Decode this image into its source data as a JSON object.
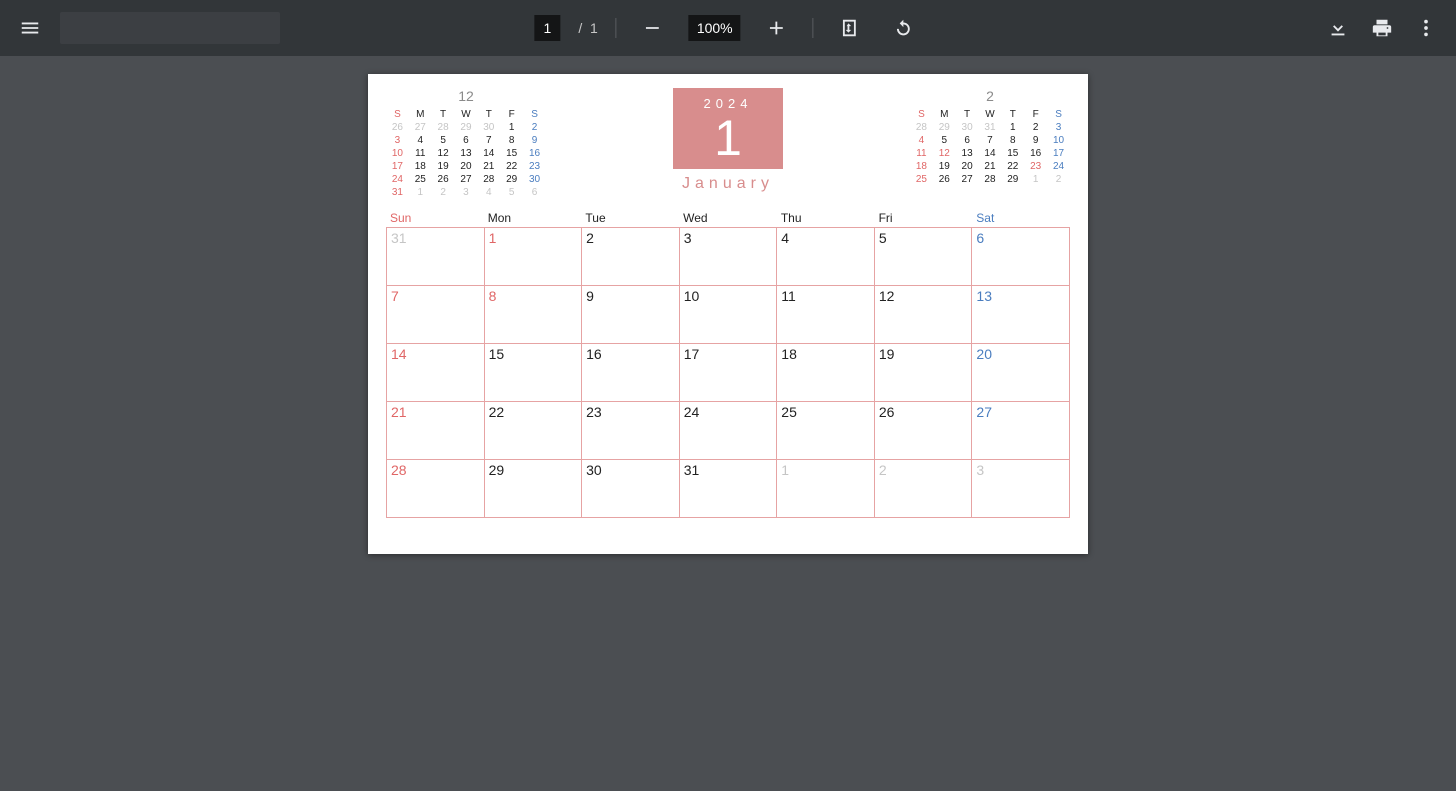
{
  "toolbar": {
    "page_current": "1",
    "page_sep": "/",
    "page_total": "1",
    "zoom": "100%"
  },
  "banner": {
    "year": "2024",
    "num": "1",
    "month": "January"
  },
  "mini_prev": {
    "title": "12",
    "dow": [
      "S",
      "M",
      "T",
      "W",
      "T",
      "F",
      "S"
    ],
    "rows": [
      [
        {
          "t": "26",
          "c": "out"
        },
        {
          "t": "27",
          "c": "out"
        },
        {
          "t": "28",
          "c": "out"
        },
        {
          "t": "29",
          "c": "out"
        },
        {
          "t": "30",
          "c": "out"
        },
        {
          "t": "1",
          "c": ""
        },
        {
          "t": "2",
          "c": "sat"
        }
      ],
      [
        {
          "t": "3",
          "c": "sun"
        },
        {
          "t": "4",
          "c": ""
        },
        {
          "t": "5",
          "c": ""
        },
        {
          "t": "6",
          "c": ""
        },
        {
          "t": "7",
          "c": ""
        },
        {
          "t": "8",
          "c": ""
        },
        {
          "t": "9",
          "c": "sat"
        }
      ],
      [
        {
          "t": "10",
          "c": "sun"
        },
        {
          "t": "11",
          "c": ""
        },
        {
          "t": "12",
          "c": ""
        },
        {
          "t": "13",
          "c": ""
        },
        {
          "t": "14",
          "c": ""
        },
        {
          "t": "15",
          "c": ""
        },
        {
          "t": "16",
          "c": "sat"
        }
      ],
      [
        {
          "t": "17",
          "c": "sun"
        },
        {
          "t": "18",
          "c": ""
        },
        {
          "t": "19",
          "c": ""
        },
        {
          "t": "20",
          "c": ""
        },
        {
          "t": "21",
          "c": ""
        },
        {
          "t": "22",
          "c": ""
        },
        {
          "t": "23",
          "c": "sat"
        }
      ],
      [
        {
          "t": "24",
          "c": "sun"
        },
        {
          "t": "25",
          "c": ""
        },
        {
          "t": "26",
          "c": ""
        },
        {
          "t": "27",
          "c": ""
        },
        {
          "t": "28",
          "c": ""
        },
        {
          "t": "29",
          "c": ""
        },
        {
          "t": "30",
          "c": "sat"
        }
      ],
      [
        {
          "t": "31",
          "c": "sun"
        },
        {
          "t": "1",
          "c": "out"
        },
        {
          "t": "2",
          "c": "out"
        },
        {
          "t": "3",
          "c": "out"
        },
        {
          "t": "4",
          "c": "out"
        },
        {
          "t": "5",
          "c": "out"
        },
        {
          "t": "6",
          "c": "out"
        }
      ]
    ]
  },
  "mini_next": {
    "title": "2",
    "dow": [
      "S",
      "M",
      "T",
      "W",
      "T",
      "F",
      "S"
    ],
    "rows": [
      [
        {
          "t": "28",
          "c": "out"
        },
        {
          "t": "29",
          "c": "out"
        },
        {
          "t": "30",
          "c": "out"
        },
        {
          "t": "31",
          "c": "out"
        },
        {
          "t": "1",
          "c": ""
        },
        {
          "t": "2",
          "c": ""
        },
        {
          "t": "3",
          "c": "sat"
        }
      ],
      [
        {
          "t": "4",
          "c": "sun"
        },
        {
          "t": "5",
          "c": ""
        },
        {
          "t": "6",
          "c": ""
        },
        {
          "t": "7",
          "c": ""
        },
        {
          "t": "8",
          "c": ""
        },
        {
          "t": "9",
          "c": ""
        },
        {
          "t": "10",
          "c": "sat"
        }
      ],
      [
        {
          "t": "11",
          "c": "hol"
        },
        {
          "t": "12",
          "c": "hol"
        },
        {
          "t": "13",
          "c": ""
        },
        {
          "t": "14",
          "c": ""
        },
        {
          "t": "15",
          "c": ""
        },
        {
          "t": "16",
          "c": ""
        },
        {
          "t": "17",
          "c": "sat"
        }
      ],
      [
        {
          "t": "18",
          "c": "sun"
        },
        {
          "t": "19",
          "c": ""
        },
        {
          "t": "20",
          "c": ""
        },
        {
          "t": "21",
          "c": ""
        },
        {
          "t": "22",
          "c": ""
        },
        {
          "t": "23",
          "c": "hol"
        },
        {
          "t": "24",
          "c": "sat"
        }
      ],
      [
        {
          "t": "25",
          "c": "sun"
        },
        {
          "t": "26",
          "c": ""
        },
        {
          "t": "27",
          "c": ""
        },
        {
          "t": "28",
          "c": ""
        },
        {
          "t": "29",
          "c": ""
        },
        {
          "t": "1",
          "c": "out"
        },
        {
          "t": "2",
          "c": "out"
        }
      ]
    ]
  },
  "big": {
    "dow": [
      "Sun",
      "Mon",
      "Tue",
      "Wed",
      "Thu",
      "Fri",
      "Sat"
    ],
    "cells": [
      {
        "t": "31",
        "c": "out"
      },
      {
        "t": "1",
        "c": "hol"
      },
      {
        "t": "2",
        "c": ""
      },
      {
        "t": "3",
        "c": ""
      },
      {
        "t": "4",
        "c": ""
      },
      {
        "t": "5",
        "c": ""
      },
      {
        "t": "6",
        "c": "sat"
      },
      {
        "t": "7",
        "c": "sun"
      },
      {
        "t": "8",
        "c": "hol"
      },
      {
        "t": "9",
        "c": ""
      },
      {
        "t": "10",
        "c": ""
      },
      {
        "t": "11",
        "c": ""
      },
      {
        "t": "12",
        "c": ""
      },
      {
        "t": "13",
        "c": "sat"
      },
      {
        "t": "14",
        "c": "sun"
      },
      {
        "t": "15",
        "c": ""
      },
      {
        "t": "16",
        "c": ""
      },
      {
        "t": "17",
        "c": ""
      },
      {
        "t": "18",
        "c": ""
      },
      {
        "t": "19",
        "c": ""
      },
      {
        "t": "20",
        "c": "sat"
      },
      {
        "t": "21",
        "c": "sun"
      },
      {
        "t": "22",
        "c": ""
      },
      {
        "t": "23",
        "c": ""
      },
      {
        "t": "24",
        "c": ""
      },
      {
        "t": "25",
        "c": ""
      },
      {
        "t": "26",
        "c": ""
      },
      {
        "t": "27",
        "c": "sat"
      },
      {
        "t": "28",
        "c": "sun"
      },
      {
        "t": "29",
        "c": ""
      },
      {
        "t": "30",
        "c": ""
      },
      {
        "t": "31",
        "c": ""
      },
      {
        "t": "1",
        "c": "out"
      },
      {
        "t": "2",
        "c": "out"
      },
      {
        "t": "3",
        "c": "out"
      }
    ]
  }
}
